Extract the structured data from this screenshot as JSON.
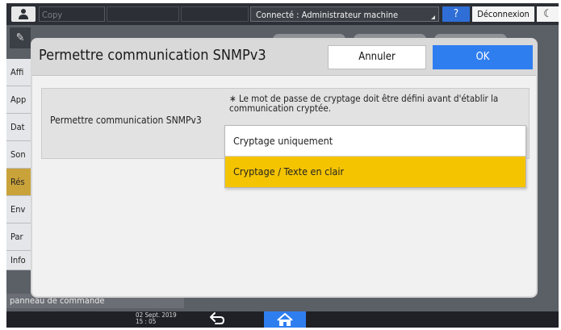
{
  "topbar": {
    "app_label": "Copy",
    "connected_text": "Connecté : Administrateur machine",
    "help_label": "?",
    "logout_label": "Déconnexion",
    "moon_symbol": "☾"
  },
  "background": {
    "sidebar_items": [
      "Affi",
      "App",
      "Dat",
      "Son",
      "Rés",
      "Env",
      "Par",
      "Info"
    ],
    "selected_index": 4,
    "bottom_text": "panneau de commande"
  },
  "dialog": {
    "title": "Permettre communication SNMPv3",
    "cancel_label": "Annuler",
    "ok_label": "OK",
    "setting_label": "Permettre communication SNMPv3",
    "note": "∗ Le mot de passe de cryptage doit être défini avant d'établir la communication cryptée.",
    "options": [
      "Cryptage uniquement",
      "Cryptage / Texte en clair"
    ],
    "selected_option_index": 1
  },
  "statusbar": {
    "date": "02 Sept. 2019",
    "time": "15 : 05"
  },
  "colors": {
    "accent_blue": "#2f7ef0",
    "selected_yellow": "#f5c400",
    "selected_item": "#c9a23a"
  }
}
